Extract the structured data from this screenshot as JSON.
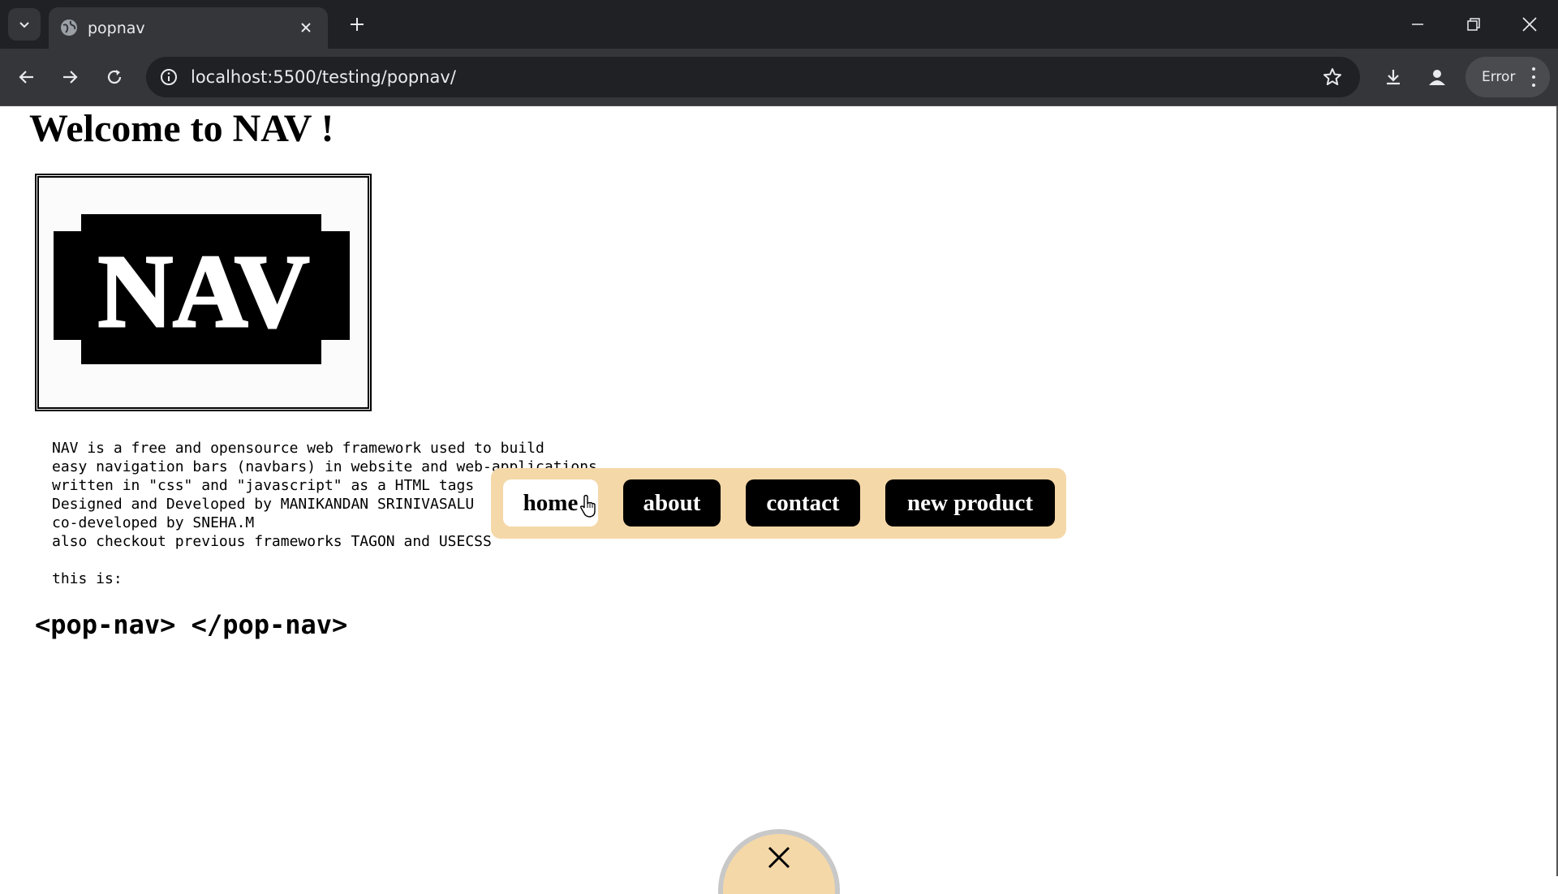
{
  "browser": {
    "tab_title": "popnav",
    "url": "localhost:5500/testing/popnav/",
    "profile_status": "Error"
  },
  "page": {
    "heading": "Welcome to NAV !",
    "logo_text": "NAV",
    "description_lines": [
      "NAV is a free and opensource web framework used to build",
      "easy navigation bars (navbars) in website and web-applications",
      "written in \"css\" and \"javascript\" as a HTML tags",
      "Designed and Developed by MANIKANDAN SRINIVASALU",
      "co-developed by SNEHA.M",
      "also checkout previous frameworks TAGON and USECSS",
      "",
      "this is:"
    ],
    "tag_example": "<pop-nav> </pop-nav>"
  },
  "popnav": {
    "items": [
      {
        "label": "home",
        "active": true
      },
      {
        "label": "about",
        "active": false
      },
      {
        "label": "contact",
        "active": false
      },
      {
        "label": "new product",
        "active": false
      }
    ],
    "colors": {
      "panel": "#f5d8a8",
      "button": "#000000",
      "active_button": "#ffffff"
    }
  },
  "icons": [
    "tab-search-icon",
    "globe-icon",
    "close-icon",
    "plus-icon",
    "minimize-icon",
    "restore-icon",
    "back-icon",
    "forward-icon",
    "reload-icon",
    "site-info-icon",
    "star-icon",
    "download-icon",
    "profile-icon",
    "more-icon",
    "cursor-icon"
  ]
}
